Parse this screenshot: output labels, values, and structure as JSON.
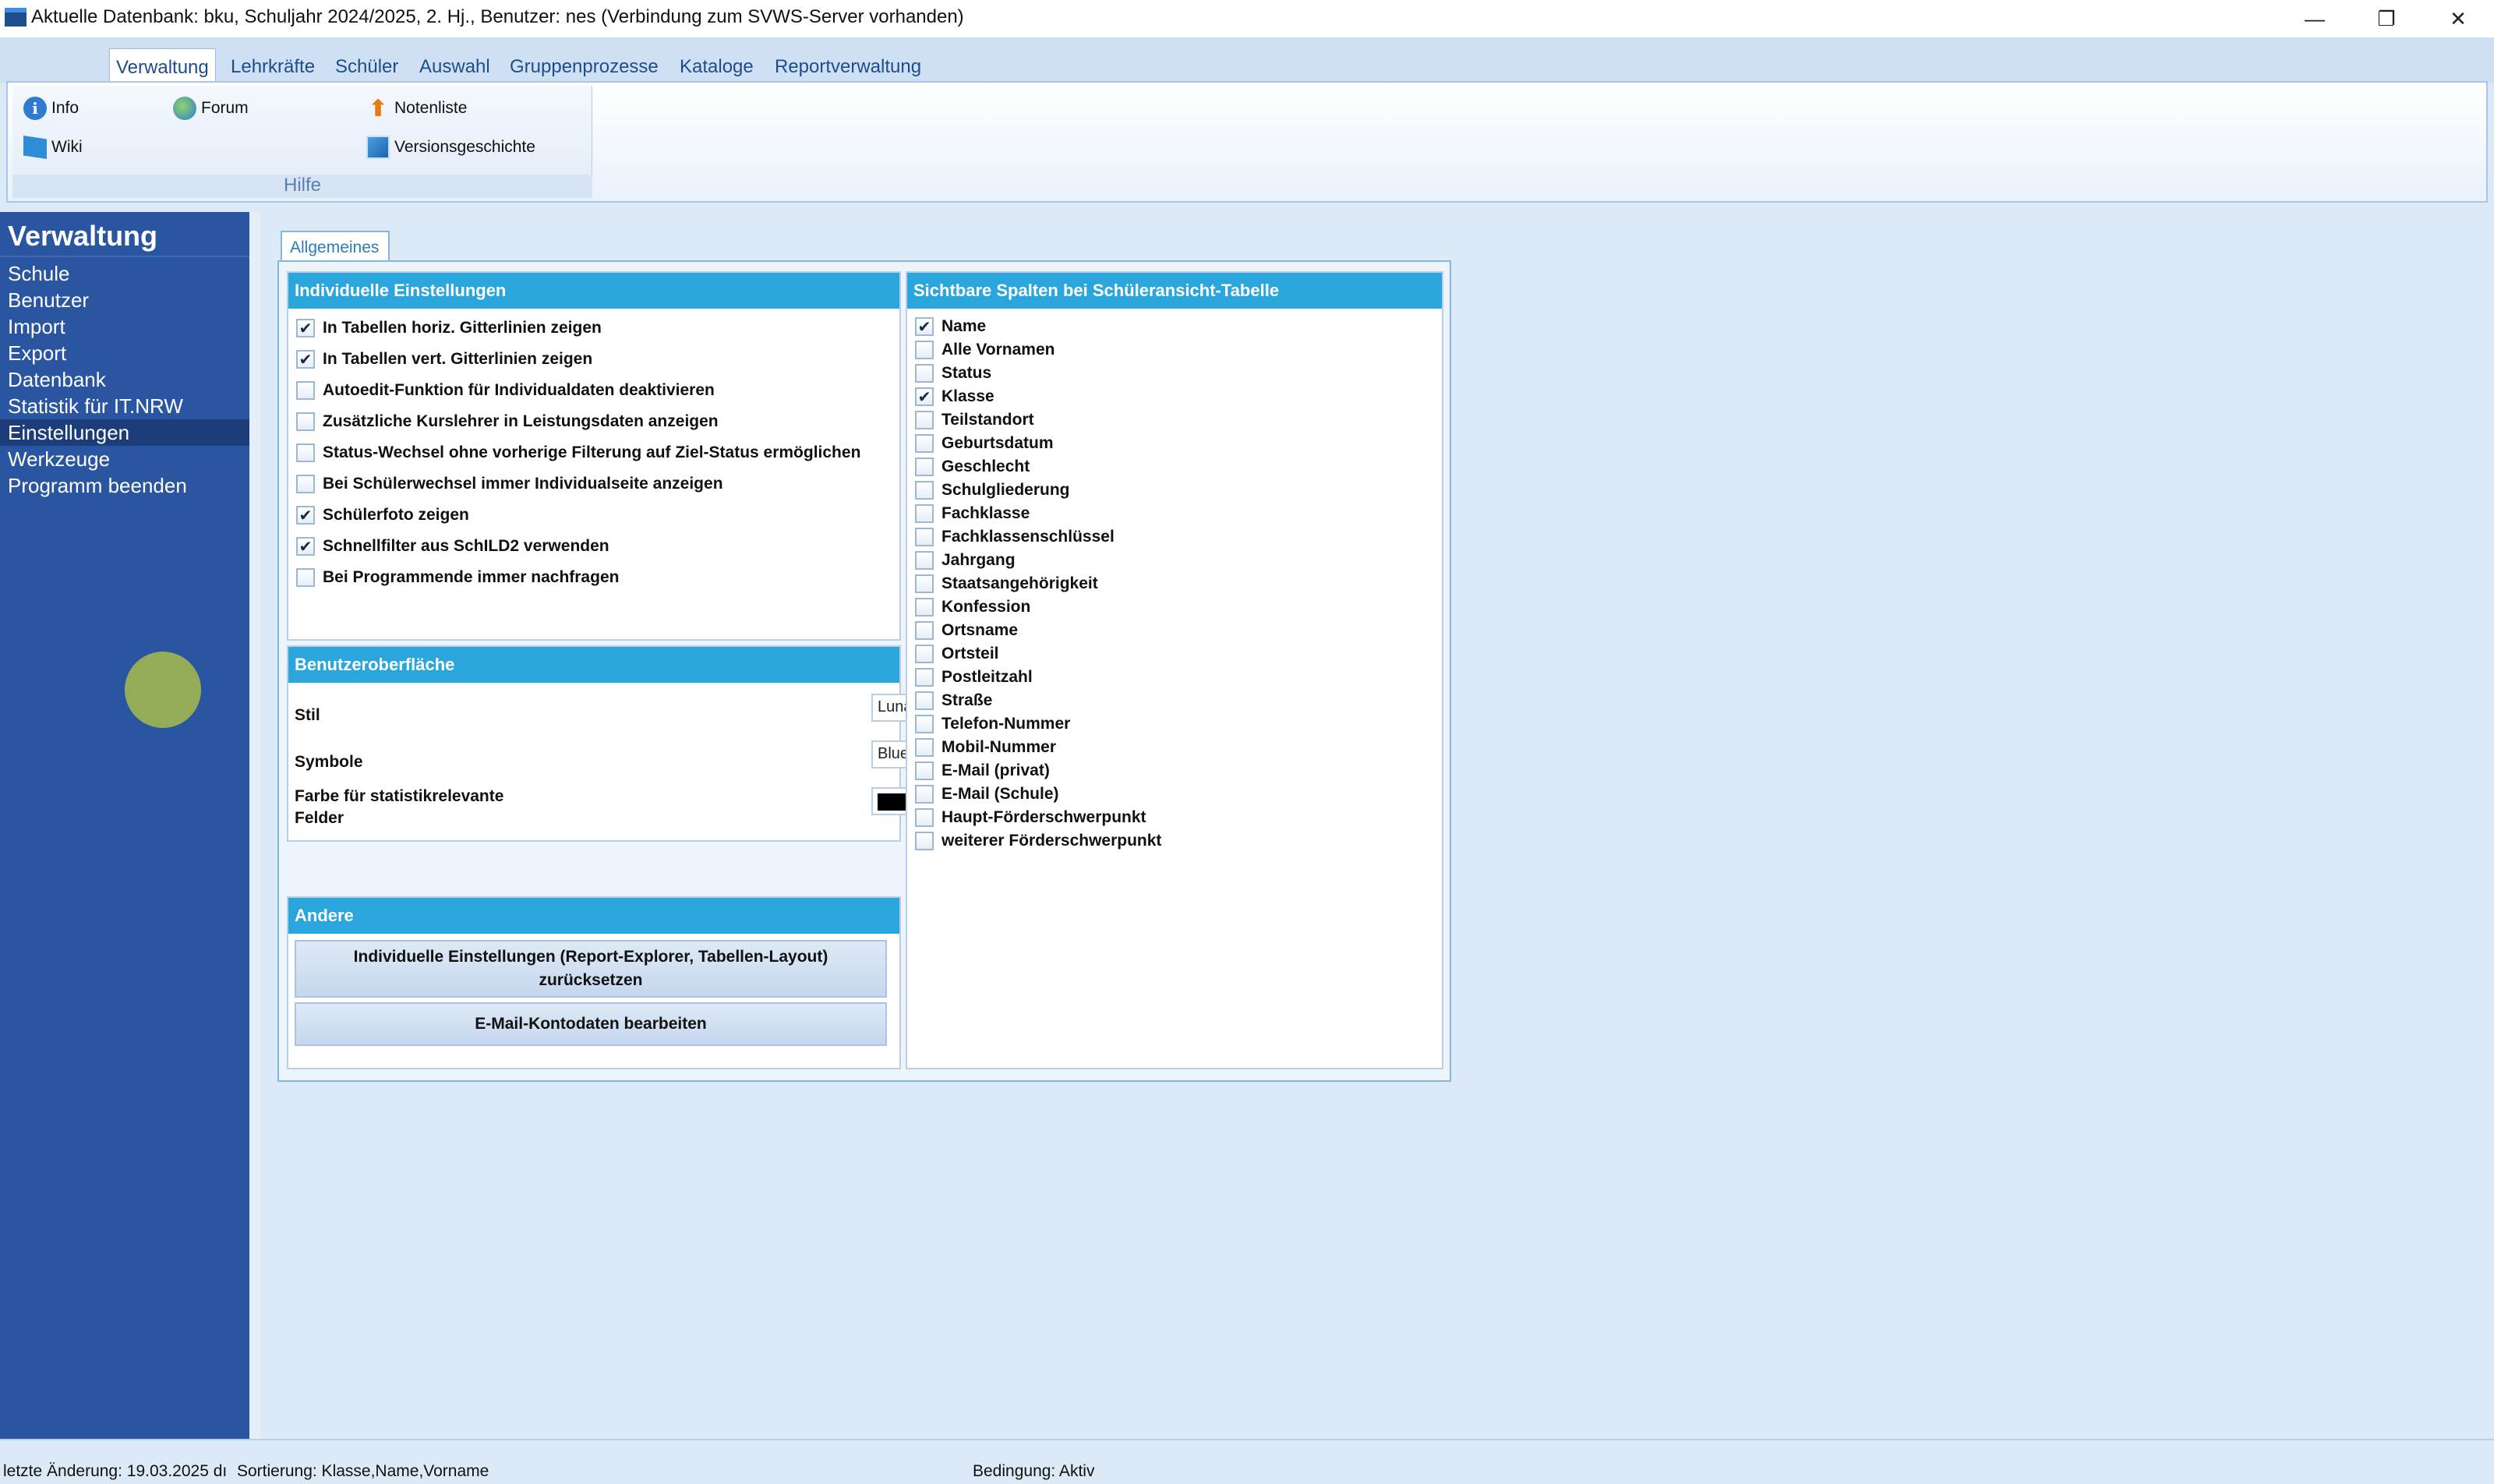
{
  "window": {
    "title": "Aktuelle Datenbank: bku, Schuljahr 2024/2025, 2. Hj., Benutzer: nes (Verbindung zum SVWS-Server vorhanden)",
    "minimize": "—",
    "maximize": "❐",
    "close": "✕"
  },
  "ribbon": {
    "tabs": [
      "Verwaltung",
      "Lehrkräfte",
      "Schüler",
      "Auswahl",
      "Gruppenprozesse",
      "Kataloge",
      "Reportverwaltung"
    ],
    "collapse_glyph": "︿",
    "help_glyph": "?",
    "buttons": {
      "info": "Info",
      "forum": "Forum",
      "notenliste": "Notenliste",
      "wiki": "Wiki",
      "versionsgeschichte": "Versionsgeschichte"
    },
    "group_label": "Hilfe"
  },
  "sidebar": {
    "title": "Verwaltung",
    "items": [
      "Schule",
      "Benutzer",
      "Import",
      "Export",
      "Datenbank",
      "Statistik für IT.NRW",
      "Einstellungen",
      "Werkzeuge",
      "Programm beenden"
    ],
    "selected": "Einstellungen"
  },
  "content": {
    "tab": "Allgemeines",
    "individuelle": {
      "header": "Individuelle Einstellungen",
      "options": [
        {
          "label": "In Tabellen horiz. Gitterlinien zeigen",
          "checked": true,
          "mark": "✔"
        },
        {
          "label": "In Tabellen vert. Gitterlinien zeigen",
          "checked": true,
          "mark": "✔"
        },
        {
          "label": "Autoedit-Funktion für Individualdaten deaktivieren",
          "checked": false,
          "mark": ""
        },
        {
          "label": "Zusätzliche Kurslehrer in Leistungsdaten anzeigen",
          "checked": false,
          "mark": ""
        },
        {
          "label": "Status-Wechsel ohne vorherige Filterung auf Ziel-Status ermöglichen",
          "checked": false,
          "mark": ""
        },
        {
          "label": "Bei Schülerwechsel immer Individualseite anzeigen",
          "checked": false,
          "mark": ""
        },
        {
          "label": "Schülerfoto zeigen",
          "checked": true,
          "mark": "✔"
        },
        {
          "label": "Schnellfilter aus SchILD2 verwenden",
          "checked": true,
          "mark": "✔"
        },
        {
          "label": "Bei Programmende immer nachfragen",
          "checked": false,
          "mark": ""
        }
      ]
    },
    "oberflaeche": {
      "header": "Benutzeroberfläche",
      "stil_label": "Stil",
      "stil_value": "Luna",
      "symbole_label": "Symbole",
      "symbole_value": "Blue",
      "farbe_label_1": "Farbe für statistikrelevante",
      "farbe_label_2": "Felder",
      "farbe_value": "#000000",
      "arrow": "▾"
    },
    "andere": {
      "header": "Andere",
      "reset_line1": "Individuelle Einstellungen (Report-Explorer, Tabellen-Layout)",
      "reset_line2": "zurücksetzen",
      "email_button": "E-Mail-Kontodaten bearbeiten"
    },
    "spalten": {
      "header": "Sichtbare Spalten bei Schüleransicht-Tabelle",
      "columns": [
        {
          "label": "Name",
          "checked": true,
          "mark": "✔"
        },
        {
          "label": "Alle Vornamen",
          "checked": false,
          "mark": ""
        },
        {
          "label": "Status",
          "checked": false,
          "mark": ""
        },
        {
          "label": "Klasse",
          "checked": true,
          "mark": "✔"
        },
        {
          "label": "Teilstandort",
          "checked": false,
          "mark": ""
        },
        {
          "label": "Geburtsdatum",
          "checked": false,
          "mark": ""
        },
        {
          "label": "Geschlecht",
          "checked": false,
          "mark": ""
        },
        {
          "label": "Schulgliederung",
          "checked": false,
          "mark": ""
        },
        {
          "label": "Fachklasse",
          "checked": false,
          "mark": ""
        },
        {
          "label": "Fachklassenschlüssel",
          "checked": false,
          "mark": ""
        },
        {
          "label": "Jahrgang",
          "checked": false,
          "mark": ""
        },
        {
          "label": "Staatsangehörigkeit",
          "checked": false,
          "mark": ""
        },
        {
          "label": "Konfession",
          "checked": false,
          "mark": ""
        },
        {
          "label": "Ortsname",
          "checked": false,
          "mark": ""
        },
        {
          "label": "Ortsteil",
          "checked": false,
          "mark": ""
        },
        {
          "label": "Postleitzahl",
          "checked": false,
          "mark": ""
        },
        {
          "label": "Straße",
          "checked": false,
          "mark": ""
        },
        {
          "label": "Telefon-Nummer",
          "checked": false,
          "mark": ""
        },
        {
          "label": "Mobil-Nummer",
          "checked": false,
          "mark": ""
        },
        {
          "label": "E-Mail (privat)",
          "checked": false,
          "mark": ""
        },
        {
          "label": "E-Mail (Schule)",
          "checked": false,
          "mark": ""
        },
        {
          "label": "Haupt-Förderschwerpunkt",
          "checked": false,
          "mark": ""
        },
        {
          "label": "weiterer Förderschwerpunkt",
          "checked": false,
          "mark": ""
        }
      ]
    }
  },
  "status": {
    "letzte_aenderung": "letzte Änderung: 19.03.2025 dı",
    "sortierung": "Sortierung: Klasse,Name,Vorname",
    "bedingung": "Bedingung: Aktiv"
  }
}
